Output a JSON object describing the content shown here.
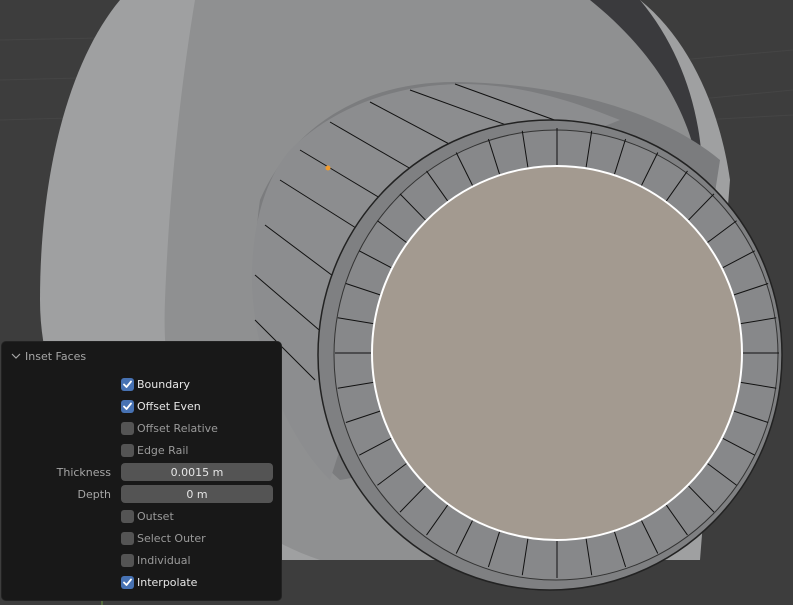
{
  "viewport": {
    "background": "#3d3d3d",
    "mesh_color": "#8a8b8c",
    "selected_face_color": "#a39a90",
    "selected_edge_color": "#ffffff",
    "vertex_color": "#f09a2c"
  },
  "operator_panel": {
    "title": "Inset Faces",
    "options": [
      {
        "label": "Boundary",
        "checked": true
      },
      {
        "label": "Offset Even",
        "checked": true
      },
      {
        "label": "Offset Relative",
        "checked": false
      },
      {
        "label": "Edge Rail",
        "checked": false
      }
    ],
    "fields": [
      {
        "label": "Thickness",
        "value": "0.0015 m"
      },
      {
        "label": "Depth",
        "value": "0 m"
      }
    ],
    "options2": [
      {
        "label": "Outset",
        "checked": false
      },
      {
        "label": "Select Outer",
        "checked": false
      },
      {
        "label": "Individual",
        "checked": false
      },
      {
        "label": "Interpolate",
        "checked": true
      }
    ]
  }
}
